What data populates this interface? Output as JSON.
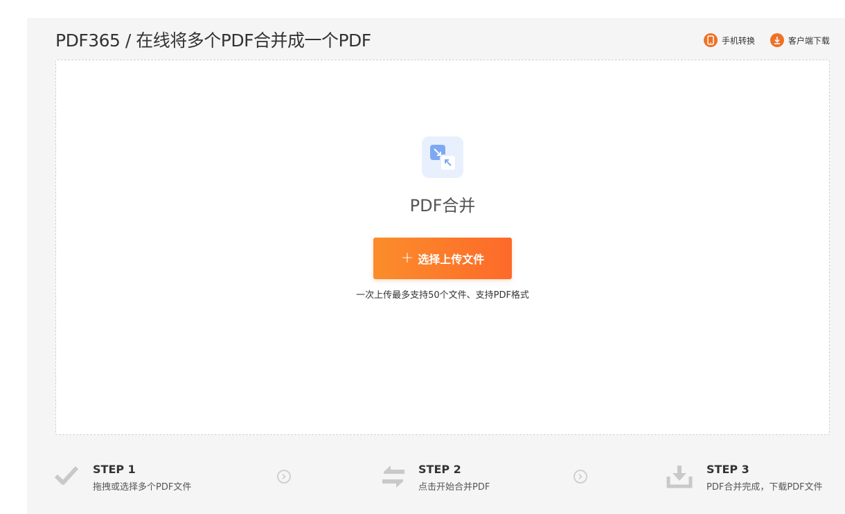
{
  "header": {
    "title": "PDF365 / 在线将多个PDF合并成一个PDF",
    "links": [
      {
        "label": "手机转换",
        "icon": "mobile-icon"
      },
      {
        "label": "客户端下载",
        "icon": "download-icon"
      }
    ]
  },
  "tool": {
    "name": "PDF合并",
    "icon": "merge-arrows-icon",
    "upload_button": {
      "plus": "+",
      "label": "选择上传文件"
    },
    "hint": "一次上传最多支持50个文件、支持PDF格式"
  },
  "steps": [
    {
      "title": "STEP 1",
      "desc": "拖拽或选择多个PDF文件",
      "icon": "check-icon"
    },
    {
      "title": "STEP 2",
      "desc": "点击开始合并PDF",
      "icon": "swap-arrows-icon"
    },
    {
      "title": "STEP 3",
      "desc": "PDF合并完成，下载PDF文件",
      "icon": "tray-download-icon"
    }
  ],
  "colors": {
    "accent": "#f07126",
    "button_start": "#fb8d2b",
    "button_end": "#fd6a2a",
    "panel_bg": "#f5f5f5",
    "icon_tile": "#e8f0fd"
  }
}
